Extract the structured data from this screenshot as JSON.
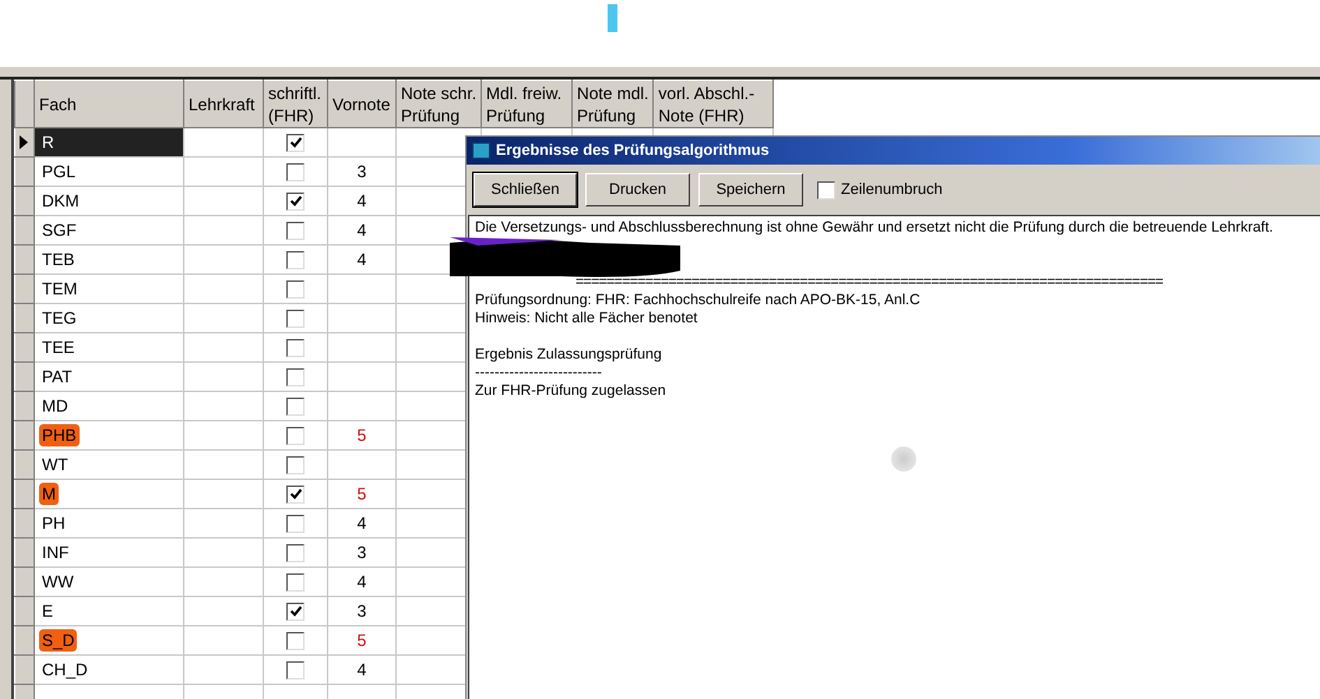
{
  "grid": {
    "columns": [
      "Fach",
      "Lehrkraft",
      "schriftl.\n(FHR)",
      "Vornote",
      "Note schr.\nPrüfung",
      "Mdl. freiw.\nPrüfung",
      "Note mdl.\nPrüfung",
      "vorl. Abschl.-\nNote (FHR)"
    ],
    "rows": [
      {
        "subject": "R",
        "selected": true,
        "highlighted": false,
        "written": true
      },
      {
        "subject": "PGL",
        "selected": false,
        "highlighted": false,
        "written": false,
        "grade": "3",
        "color": "#000000"
      },
      {
        "subject": "DKM",
        "selected": false,
        "highlighted": false,
        "written": true,
        "grade": "4",
        "color": "#000000"
      },
      {
        "subject": "SGF",
        "selected": false,
        "highlighted": false,
        "written": false,
        "grade": "4",
        "color": "#000000"
      },
      {
        "subject": "TEB",
        "selected": false,
        "highlighted": false,
        "written": false,
        "grade": "4",
        "color": "#000000"
      },
      {
        "subject": "TEM",
        "selected": false,
        "highlighted": false,
        "written": false
      },
      {
        "subject": "TEG",
        "selected": false,
        "highlighted": false,
        "written": false
      },
      {
        "subject": "TEE",
        "selected": false,
        "highlighted": false,
        "written": false
      },
      {
        "subject": "PAT",
        "selected": false,
        "highlighted": false,
        "written": false
      },
      {
        "subject": "MD",
        "selected": false,
        "highlighted": false,
        "written": false
      },
      {
        "subject": "PHB",
        "selected": false,
        "highlighted": true,
        "written": false,
        "grade": "5",
        "color": "#d01010"
      },
      {
        "subject": "WT",
        "selected": false,
        "highlighted": false,
        "written": false
      },
      {
        "subject": "M",
        "selected": false,
        "highlighted": true,
        "written": true,
        "grade": "5",
        "color": "#d01010"
      },
      {
        "subject": "PH",
        "selected": false,
        "highlighted": false,
        "written": false,
        "grade": "4",
        "color": "#000000"
      },
      {
        "subject": "INF",
        "selected": false,
        "highlighted": false,
        "written": false,
        "grade": "3",
        "color": "#000000"
      },
      {
        "subject": "WW",
        "selected": false,
        "highlighted": false,
        "written": false,
        "grade": "4",
        "color": "#000000"
      },
      {
        "subject": "E",
        "selected": false,
        "highlighted": false,
        "written": true,
        "grade": "3",
        "color": "#000000"
      },
      {
        "subject": "S_D",
        "selected": false,
        "highlighted": true,
        "written": false,
        "grade": "5",
        "color": "#d01010"
      },
      {
        "subject": "CH_D",
        "selected": false,
        "highlighted": false,
        "written": false,
        "grade": "4",
        "color": "#000000"
      }
    ]
  },
  "dialog": {
    "title": "Ergebnisse des Prüfungsalgorithmus",
    "buttons": [
      {
        "label": "Schließen",
        "selected": true
      },
      {
        "label": "Drucken",
        "selected": false
      },
      {
        "label": "Speichern",
        "selected": false
      }
    ],
    "wrap": {
      "label": "Zeilenumbruch",
      "checked": false
    },
    "report": [
      {
        "kind": "line",
        "text": "Die Versetzungs- und Abschlussberechnung ist ohne Gewähr und ersetzt nicht die Prüfung durch die betreuende Lehrkraft."
      },
      {
        "kind": "redacted"
      },
      {
        "kind": "rule",
        "text": "============================================================================"
      },
      {
        "kind": "line",
        "text": "Prüfungsordnung: FHR: Fachhochschulreife nach APO-BK-15, Anl.C"
      },
      {
        "kind": "line",
        "text": "Hinweis: Nicht alle Fächer benotet"
      },
      {
        "kind": "blank"
      },
      {
        "kind": "line",
        "text": "Ergebnis Zulassungsprüfung"
      },
      {
        "kind": "line",
        "text": "--------------------------"
      },
      {
        "kind": "line",
        "text": "Zur FHR-Prüfung zugelassen"
      }
    ]
  }
}
